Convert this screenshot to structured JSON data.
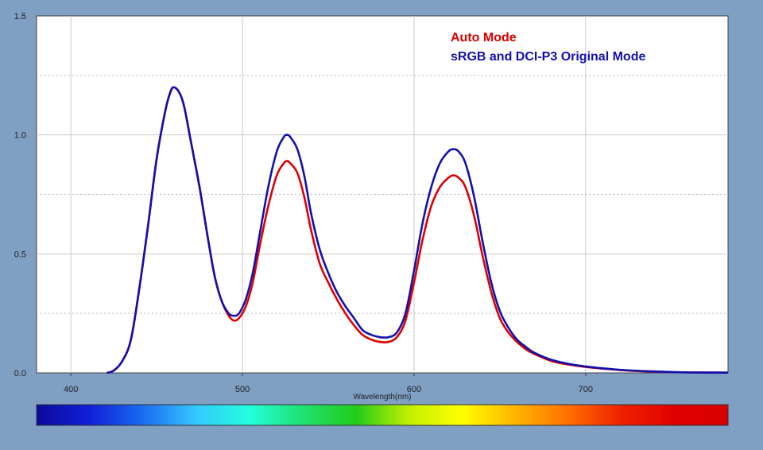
{
  "chart_data": {
    "type": "line",
    "title": "",
    "xlabel": "Wavelength(nm)",
    "ylabel": "",
    "xlim": [
      380,
      783
    ],
    "ylim": [
      0,
      1.5
    ],
    "x_ticks": [
      400,
      500,
      600,
      700
    ],
    "y_ticks": [
      0.0,
      0.5,
      1.0,
      1.5
    ],
    "x_tick_labels": [
      "400",
      "500",
      "600",
      "700"
    ],
    "y_tick_labels": [
      "0.0",
      "0.5",
      "1.0",
      "1.5"
    ],
    "grid": true,
    "legend_position": "top-right",
    "spectrum_bar": true,
    "spectrum_colors": [
      "#0b0b9a",
      "#1020d8",
      "#1a6cf0",
      "#35c8ff",
      "#22ffdc",
      "#20e070",
      "#22cc1a",
      "#c0f000",
      "#ffff00",
      "#ffb400",
      "#ff7000",
      "#ee2000",
      "#e00000",
      "#d80000"
    ],
    "series": [
      {
        "name": "Auto Mode",
        "color": "#dd0000",
        "points": [
          [
            421,
            0
          ],
          [
            425,
            0.01
          ],
          [
            430,
            0.05
          ],
          [
            435,
            0.14
          ],
          [
            440,
            0.36
          ],
          [
            445,
            0.62
          ],
          [
            450,
            0.9
          ],
          [
            455,
            1.1
          ],
          [
            458,
            1.18
          ],
          [
            460,
            1.2
          ],
          [
            463,
            1.18
          ],
          [
            466,
            1.12
          ],
          [
            470,
            0.97
          ],
          [
            475,
            0.78
          ],
          [
            480,
            0.56
          ],
          [
            484,
            0.4
          ],
          [
            488,
            0.3
          ],
          [
            492,
            0.24
          ],
          [
            495,
            0.22
          ],
          [
            498,
            0.23
          ],
          [
            502,
            0.28
          ],
          [
            506,
            0.38
          ],
          [
            510,
            0.53
          ],
          [
            515,
            0.7
          ],
          [
            520,
            0.83
          ],
          [
            524,
            0.88
          ],
          [
            526,
            0.89
          ],
          [
            528,
            0.88
          ],
          [
            532,
            0.84
          ],
          [
            536,
            0.74
          ],
          [
            540,
            0.6
          ],
          [
            545,
            0.46
          ],
          [
            550,
            0.38
          ],
          [
            555,
            0.31
          ],
          [
            560,
            0.25
          ],
          [
            565,
            0.2
          ],
          [
            570,
            0.16
          ],
          [
            575,
            0.14
          ],
          [
            580,
            0.13
          ],
          [
            585,
            0.13
          ],
          [
            590,
            0.15
          ],
          [
            595,
            0.22
          ],
          [
            600,
            0.38
          ],
          [
            605,
            0.56
          ],
          [
            610,
            0.7
          ],
          [
            615,
            0.78
          ],
          [
            620,
            0.82
          ],
          [
            623,
            0.83
          ],
          [
            626,
            0.82
          ],
          [
            630,
            0.78
          ],
          [
            635,
            0.66
          ],
          [
            640,
            0.49
          ],
          [
            645,
            0.34
          ],
          [
            650,
            0.23
          ],
          [
            655,
            0.17
          ],
          [
            660,
            0.13
          ],
          [
            665,
            0.1
          ],
          [
            670,
            0.08
          ],
          [
            680,
            0.05
          ],
          [
            690,
            0.035
          ],
          [
            700,
            0.025
          ],
          [
            720,
            0.012
          ],
          [
            740,
            0.005
          ],
          [
            760,
            0.002
          ],
          [
            783,
            0.001
          ]
        ]
      },
      {
        "name": "sRGB and DCI-P3 Original Mode",
        "color": "#1010b0",
        "points": [
          [
            421,
            0
          ],
          [
            425,
            0.01
          ],
          [
            430,
            0.05
          ],
          [
            435,
            0.14
          ],
          [
            440,
            0.36
          ],
          [
            445,
            0.62
          ],
          [
            450,
            0.9
          ],
          [
            455,
            1.1
          ],
          [
            458,
            1.18
          ],
          [
            460,
            1.2
          ],
          [
            463,
            1.18
          ],
          [
            466,
            1.12
          ],
          [
            470,
            0.97
          ],
          [
            475,
            0.78
          ],
          [
            480,
            0.56
          ],
          [
            484,
            0.4
          ],
          [
            488,
            0.3
          ],
          [
            492,
            0.25
          ],
          [
            495,
            0.24
          ],
          [
            498,
            0.25
          ],
          [
            502,
            0.31
          ],
          [
            506,
            0.42
          ],
          [
            510,
            0.58
          ],
          [
            515,
            0.78
          ],
          [
            520,
            0.93
          ],
          [
            524,
            0.99
          ],
          [
            526,
            1.0
          ],
          [
            528,
            0.99
          ],
          [
            532,
            0.94
          ],
          [
            536,
            0.83
          ],
          [
            540,
            0.67
          ],
          [
            545,
            0.52
          ],
          [
            550,
            0.42
          ],
          [
            555,
            0.34
          ],
          [
            560,
            0.28
          ],
          [
            565,
            0.23
          ],
          [
            570,
            0.18
          ],
          [
            575,
            0.16
          ],
          [
            580,
            0.15
          ],
          [
            585,
            0.15
          ],
          [
            590,
            0.17
          ],
          [
            595,
            0.25
          ],
          [
            600,
            0.43
          ],
          [
            605,
            0.63
          ],
          [
            610,
            0.78
          ],
          [
            615,
            0.88
          ],
          [
            620,
            0.93
          ],
          [
            623,
            0.94
          ],
          [
            626,
            0.93
          ],
          [
            630,
            0.88
          ],
          [
            635,
            0.74
          ],
          [
            640,
            0.55
          ],
          [
            645,
            0.38
          ],
          [
            650,
            0.26
          ],
          [
            655,
            0.19
          ],
          [
            660,
            0.14
          ],
          [
            665,
            0.11
          ],
          [
            670,
            0.085
          ],
          [
            680,
            0.055
          ],
          [
            690,
            0.038
          ],
          [
            700,
            0.027
          ],
          [
            720,
            0.013
          ],
          [
            740,
            0.006
          ],
          [
            760,
            0.002
          ],
          [
            783,
            0.001
          ]
        ]
      }
    ]
  }
}
